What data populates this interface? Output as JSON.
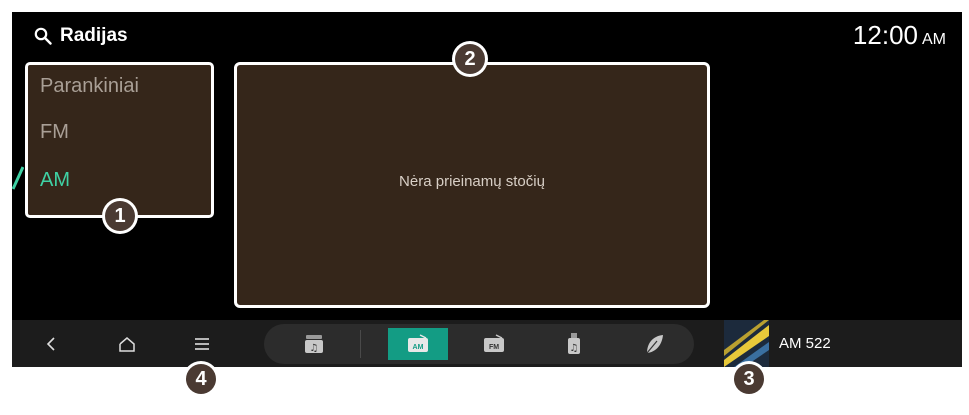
{
  "header": {
    "search_icon": "search-icon",
    "title": "Radijas",
    "time": "12:00",
    "ampm": "AM"
  },
  "menu": {
    "items": [
      {
        "label": "Parankiniai",
        "active": false
      },
      {
        "label": "FM",
        "active": false
      },
      {
        "label": "AM",
        "active": true
      }
    ]
  },
  "panel": {
    "message": "Nėra prieinamų stočių"
  },
  "bottom_bar": {
    "nav": [
      {
        "icon": "back-icon"
      },
      {
        "icon": "home-icon"
      },
      {
        "icon": "menu-icon"
      }
    ],
    "sources": [
      {
        "icon": "media-icon",
        "label": "",
        "active": false
      },
      {
        "icon": "am-radio-icon",
        "label": "AM",
        "active": true
      },
      {
        "icon": "fm-radio-icon",
        "label": "FM",
        "active": false
      },
      {
        "icon": "usb-music-icon",
        "label": "",
        "active": false
      },
      {
        "icon": "leaf-music-icon",
        "label": "",
        "active": false
      }
    ],
    "now_playing": "AM 522"
  },
  "callouts": [
    "1",
    "2",
    "3",
    "4"
  ],
  "colors": {
    "background": "#000000",
    "panel": "#35261a",
    "accent": "#3fd1a4",
    "active_source": "#139c84",
    "callout": "#4a3a32"
  }
}
